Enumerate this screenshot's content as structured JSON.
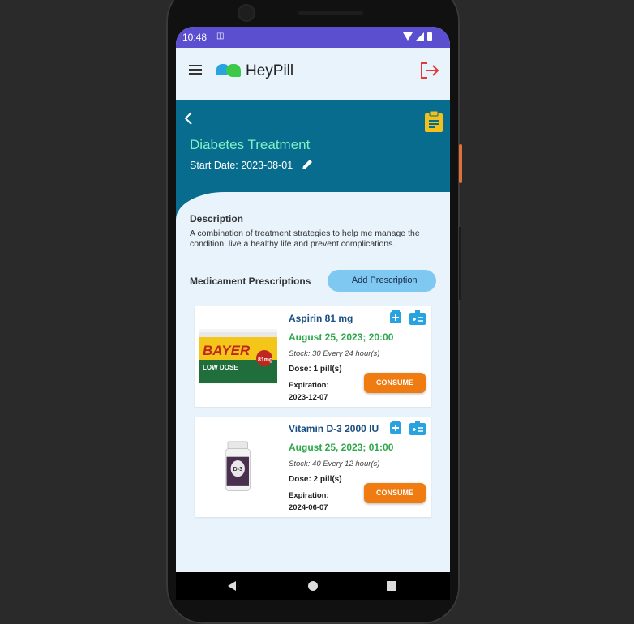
{
  "status_bar": {
    "time": "10:48",
    "sim_icon": "sim-card-icon"
  },
  "app_bar": {
    "brand": "HeyPill",
    "menu_icon": "hamburger-menu-icon",
    "logout_icon": "logout-icon"
  },
  "treatment": {
    "title": "Diabetes Treatment",
    "start_date": "Start Date: 2023-08-01",
    "description_label": "Description",
    "description": "A combination of treatment strategies to help me manage the condition, live a healthy life and prevent complications."
  },
  "prescriptions": {
    "label": "Medicament Prescriptions",
    "add_button": "+Add Prescription",
    "items": [
      {
        "name": "Aspirin 81 mg",
        "next_time": "August 25, 2023; 20:00",
        "stock": "Stock: 30  Every 24 hour(s)",
        "dose": "Dose: 1 pill(s)",
        "expiration_label": "Expiration:",
        "expiration": "2023-12-07",
        "consume_label": "CONSUME",
        "image_text": {
          "brand": "BAYER",
          "sub": "LOW DOSE",
          "strength": "81mg"
        }
      },
      {
        "name": "Vitamin D-3 2000 IU",
        "next_time": "August 25, 2023; 01:00",
        "stock": "Stock: 40  Every 12 hour(s)",
        "dose": "Dose: 2 pill(s)",
        "expiration_label": "Expiration:",
        "expiration": "2024-06-07",
        "consume_label": "CONSUME",
        "image_text": {
          "label": "D-3"
        }
      }
    ]
  },
  "colors": {
    "status_bar": "#5b4fcf",
    "hero": "#076c8e",
    "title_accent": "#7ff1c4",
    "time_green": "#2ea84a",
    "consume_orange": "#f07b11",
    "add_button": "#7fc8f2",
    "logout_red": "#e53935",
    "clipboard_yellow": "#f2c21b"
  }
}
